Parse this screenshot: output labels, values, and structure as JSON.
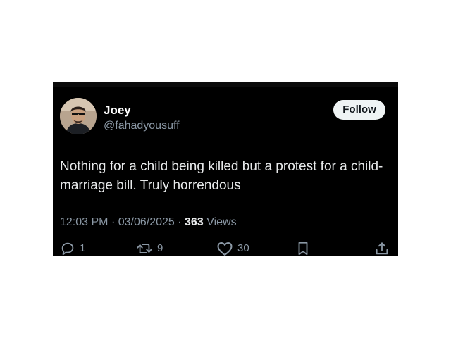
{
  "user": {
    "display_name": "Joey",
    "handle": "@fahadyousuff"
  },
  "follow_label": "Follow",
  "tweet": {
    "text": "Nothing for a child being killed but a protest for a child-marriage bill. Truly horrendous",
    "time": "12:03 PM",
    "date": "03/06/2025",
    "views_count": "363",
    "views_label": "Views"
  },
  "actions": {
    "replies": "1",
    "reposts": "9",
    "likes": "30"
  },
  "icons": {
    "reply": "reply-icon",
    "repost": "repost-icon",
    "like": "heart-icon",
    "bookmark": "bookmark-icon",
    "share": "share-icon"
  },
  "colors": {
    "background": "#000000",
    "text_primary": "#e7e9ea",
    "text_secondary": "#8b98a5",
    "follow_bg": "#eff3f4"
  }
}
